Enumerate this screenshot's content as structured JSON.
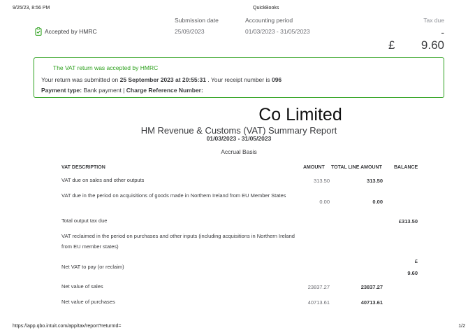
{
  "print_header": {
    "datetime": "9/25/23, 8:56 PM",
    "title": "QuickBooks"
  },
  "print_footer": {
    "url": "https://app.qbo.intuit.com/app/tax/report?returnId=",
    "page": "1/2"
  },
  "status": {
    "label": "Accepted by HMRC",
    "color": "#2ca01c"
  },
  "columns": {
    "submission_date_label": "Submission date",
    "submission_date": "25/09/2023",
    "accounting_period_label": "Accounting period",
    "accounting_period": "01/03/2023 - 31/05/2023",
    "tax_due_label": "Tax due",
    "tax_due_sign": "-",
    "tax_due_currency": "£",
    "tax_due_amount": "9.60"
  },
  "banner": {
    "title": "The VAT return was accepted by HMRC",
    "line2_prefix": "Your return was submitted on ",
    "line2_datetime": "25 September 2023 at 20:55:31",
    "line2_suffix": " . Your receipt number is ",
    "line2_receipt": "096",
    "line3_label": "Payment type:",
    "line3_value": " Bank payment | ",
    "line3_ref_label": "Charge Reference Number:"
  },
  "report": {
    "company": "Co Limited",
    "title": "HM Revenue & Customs (VAT) Summary Report",
    "period": "01/03/2023 - 31/05/2023",
    "basis": "Accrual Basis"
  },
  "table": {
    "headers": {
      "description": "VAT DESCRIPTION",
      "amount": "AMOUNT",
      "total_line_amount": "TOTAL LINE AMOUNT",
      "balance": "BALANCE"
    },
    "rows": [
      {
        "description": "VAT due on sales and other outputs",
        "amount": "313.50",
        "total": "313.50",
        "balance": ""
      },
      {
        "description": "VAT due in the period on acquisitions of goods made in Northern Ireland from EU Member States",
        "amount": "0.00",
        "total": "0.00",
        "balance": ""
      },
      {
        "description": "Total output tax due",
        "amount": "",
        "total": "",
        "balance": "£313.50"
      },
      {
        "description": "VAT reclaimed in the period on purchases and other inputs (including acquisitions in Northern Ireland from EU member states)",
        "amount": "",
        "total": "",
        "balance": ""
      },
      {
        "description": "Net VAT to pay (or reclaim)",
        "amount": "",
        "total": "",
        "balance_currency": "£",
        "balance": "9.60"
      },
      {
        "description": "Net value of sales",
        "amount": "23837.27",
        "total": "23837.27",
        "balance": ""
      },
      {
        "description": "Net value of purchases",
        "amount": "40713.61",
        "total": "40713.61",
        "balance": ""
      }
    ]
  }
}
